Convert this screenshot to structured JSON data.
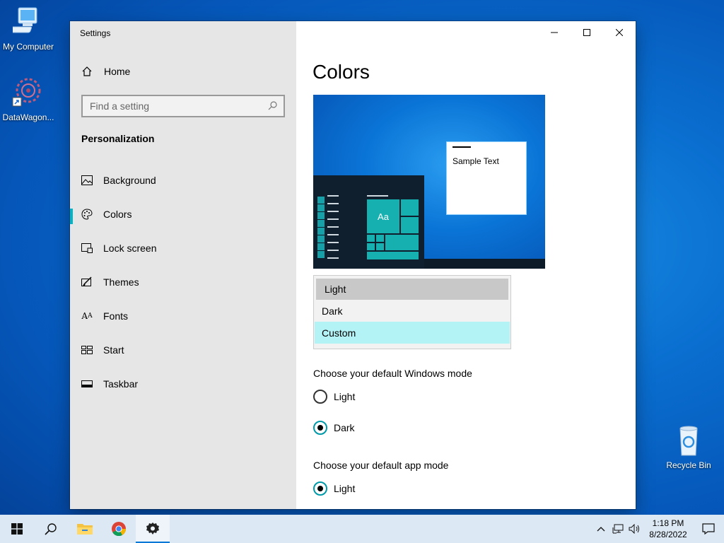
{
  "desktop": {
    "icons": [
      {
        "label": "My Computer"
      },
      {
        "label": "DataWagon..."
      },
      {
        "label": "Recycle Bin"
      }
    ]
  },
  "window": {
    "title": "Settings",
    "controls": {
      "minimize": "minimize-icon",
      "maximize": "maximize-icon",
      "close": "close-icon"
    }
  },
  "sidebar": {
    "home_label": "Home",
    "search_placeholder": "Find a setting",
    "section_title": "Personalization",
    "items": [
      {
        "label": "Background",
        "icon": "picture-icon"
      },
      {
        "label": "Colors",
        "icon": "palette-icon",
        "active": true
      },
      {
        "label": "Lock screen",
        "icon": "lock-screen-icon"
      },
      {
        "label": "Themes",
        "icon": "themes-icon"
      },
      {
        "label": "Fonts",
        "icon": "fonts-icon"
      },
      {
        "label": "Start",
        "icon": "start-icon"
      },
      {
        "label": "Taskbar",
        "icon": "taskbar-icon"
      }
    ]
  },
  "main": {
    "title": "Colors",
    "preview": {
      "sample_text": "Sample Text",
      "tile_text": "Aa"
    },
    "color_dropdown": {
      "options": [
        "Light",
        "Dark",
        "Custom"
      ],
      "selected": "Light",
      "highlighted": "Custom"
    },
    "windows_mode": {
      "label": "Choose your default Windows mode",
      "options": [
        "Light",
        "Dark"
      ],
      "selected": "Dark"
    },
    "app_mode": {
      "label": "Choose your default app mode",
      "options": [
        "Light"
      ],
      "selected": "Light"
    }
  },
  "taskbar": {
    "time": "1:18 PM",
    "date": "8/28/2022",
    "accent": "#0078d7"
  }
}
